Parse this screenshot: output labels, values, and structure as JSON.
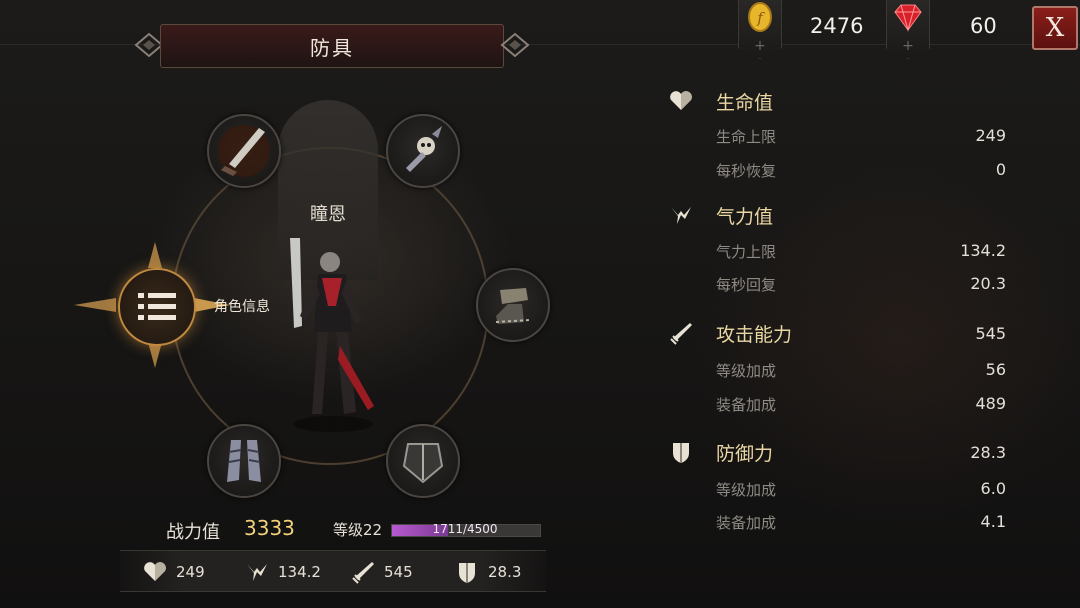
{
  "header": {
    "title": "防具",
    "close_label": "X"
  },
  "currency": {
    "gold": {
      "icon": "gold-coin-icon",
      "value": "2476"
    },
    "gems": {
      "icon": "red-gem-icon",
      "value": "60"
    }
  },
  "character": {
    "name": "瞳恩",
    "menu_label": "角色信息",
    "power_label": "战力值",
    "power_value": "3333",
    "level_label": "等级22",
    "exp_text": "1711/4500",
    "exp_fraction": 0.38
  },
  "equipment_slots": [
    "weapon",
    "helmet",
    "gauntlet",
    "armor",
    "boots",
    "shoulder"
  ],
  "summary": [
    {
      "icon": "heart-icon",
      "value": "249"
    },
    {
      "icon": "stamina-icon",
      "value": "134.2"
    },
    {
      "icon": "sword-icon",
      "value": "545"
    },
    {
      "icon": "shield-icon",
      "value": "28.3"
    }
  ],
  "stats": {
    "hp": {
      "name": "生命值",
      "rows": [
        {
          "label": "生命上限",
          "value": "249"
        },
        {
          "label": "每秒恢复",
          "value": "0"
        }
      ]
    },
    "stamina": {
      "name": "气力值",
      "rows": [
        {
          "label": "气力上限",
          "value": "134.2"
        },
        {
          "label": "每秒回复",
          "value": "20.3"
        }
      ]
    },
    "attack": {
      "name": "攻击能力",
      "value": "545",
      "rows": [
        {
          "label": "等级加成",
          "value": "56"
        },
        {
          "label": "装备加成",
          "value": "489"
        }
      ]
    },
    "defense": {
      "name": "防御力",
      "value": "28.3",
      "rows": [
        {
          "label": "等级加成",
          "value": "6.0"
        },
        {
          "label": "装备加成",
          "value": "4.1"
        }
      ]
    }
  },
  "colors": {
    "accent_gold": "#f3d27a",
    "stat_name": "#ead7a4",
    "exp_bar": "#b85ad0",
    "close_red": "#8a1e1a"
  }
}
